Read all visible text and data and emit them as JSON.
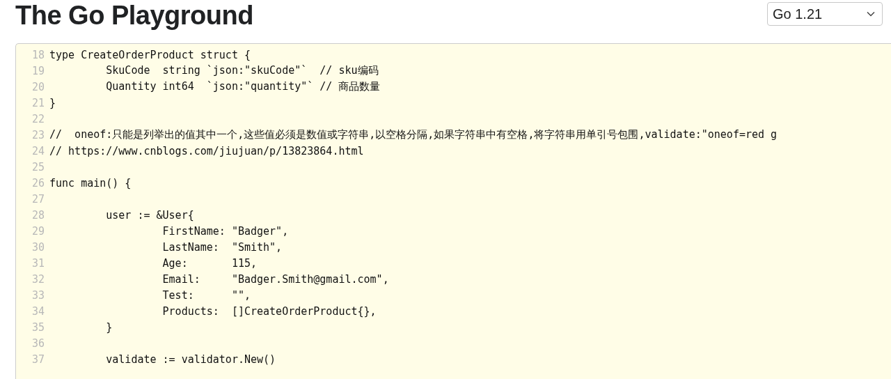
{
  "header": {
    "title": "The Go Playground",
    "version_select": {
      "value": "Go 1.21"
    }
  },
  "editor": {
    "lines": [
      {
        "number": "18",
        "text": "type CreateOrderProduct struct {"
      },
      {
        "number": "19",
        "text": "\tSkuCode  string `json:\"skuCode\"`  // sku编码"
      },
      {
        "number": "20",
        "text": "\tQuantity int64  `json:\"quantity\"` // 商品数量"
      },
      {
        "number": "21",
        "text": "}"
      },
      {
        "number": "22"
      },
      {
        "number": "23",
        "text": "//  oneof:只能是列举出的值其中一个,这些值必须是数值或字符串,以空格分隔,如果字符串中有空格,将字符串用单引号包围,validate:\"oneof=red g"
      },
      {
        "number": "24",
        "text": "// https://www.cnblogs.com/jiujuan/p/13823864.html"
      },
      {
        "number": "25"
      },
      {
        "number": "26",
        "text": "func main() {"
      },
      {
        "number": "27"
      },
      {
        "number": "28",
        "text": "\tuser := &User{"
      },
      {
        "number": "29",
        "text": "\t\tFirstName: \"Badger\","
      },
      {
        "number": "30",
        "text": "\t\tLastName:  \"Smith\","
      },
      {
        "number": "31",
        "text": "\t\tAge:       115,"
      },
      {
        "number": "32",
        "text": "\t\tEmail:     \"Badger.Smith@gmail.com\","
      },
      {
        "number": "33",
        "text": "\t\tTest:      \"\","
      },
      {
        "number": "34",
        "text": "\t\tProducts:  []CreateOrderProduct{},"
      },
      {
        "number": "35",
        "text": "\t}"
      },
      {
        "number": "36"
      },
      {
        "number": "37",
        "text": "\tvalidate := validator.New()"
      }
    ]
  }
}
